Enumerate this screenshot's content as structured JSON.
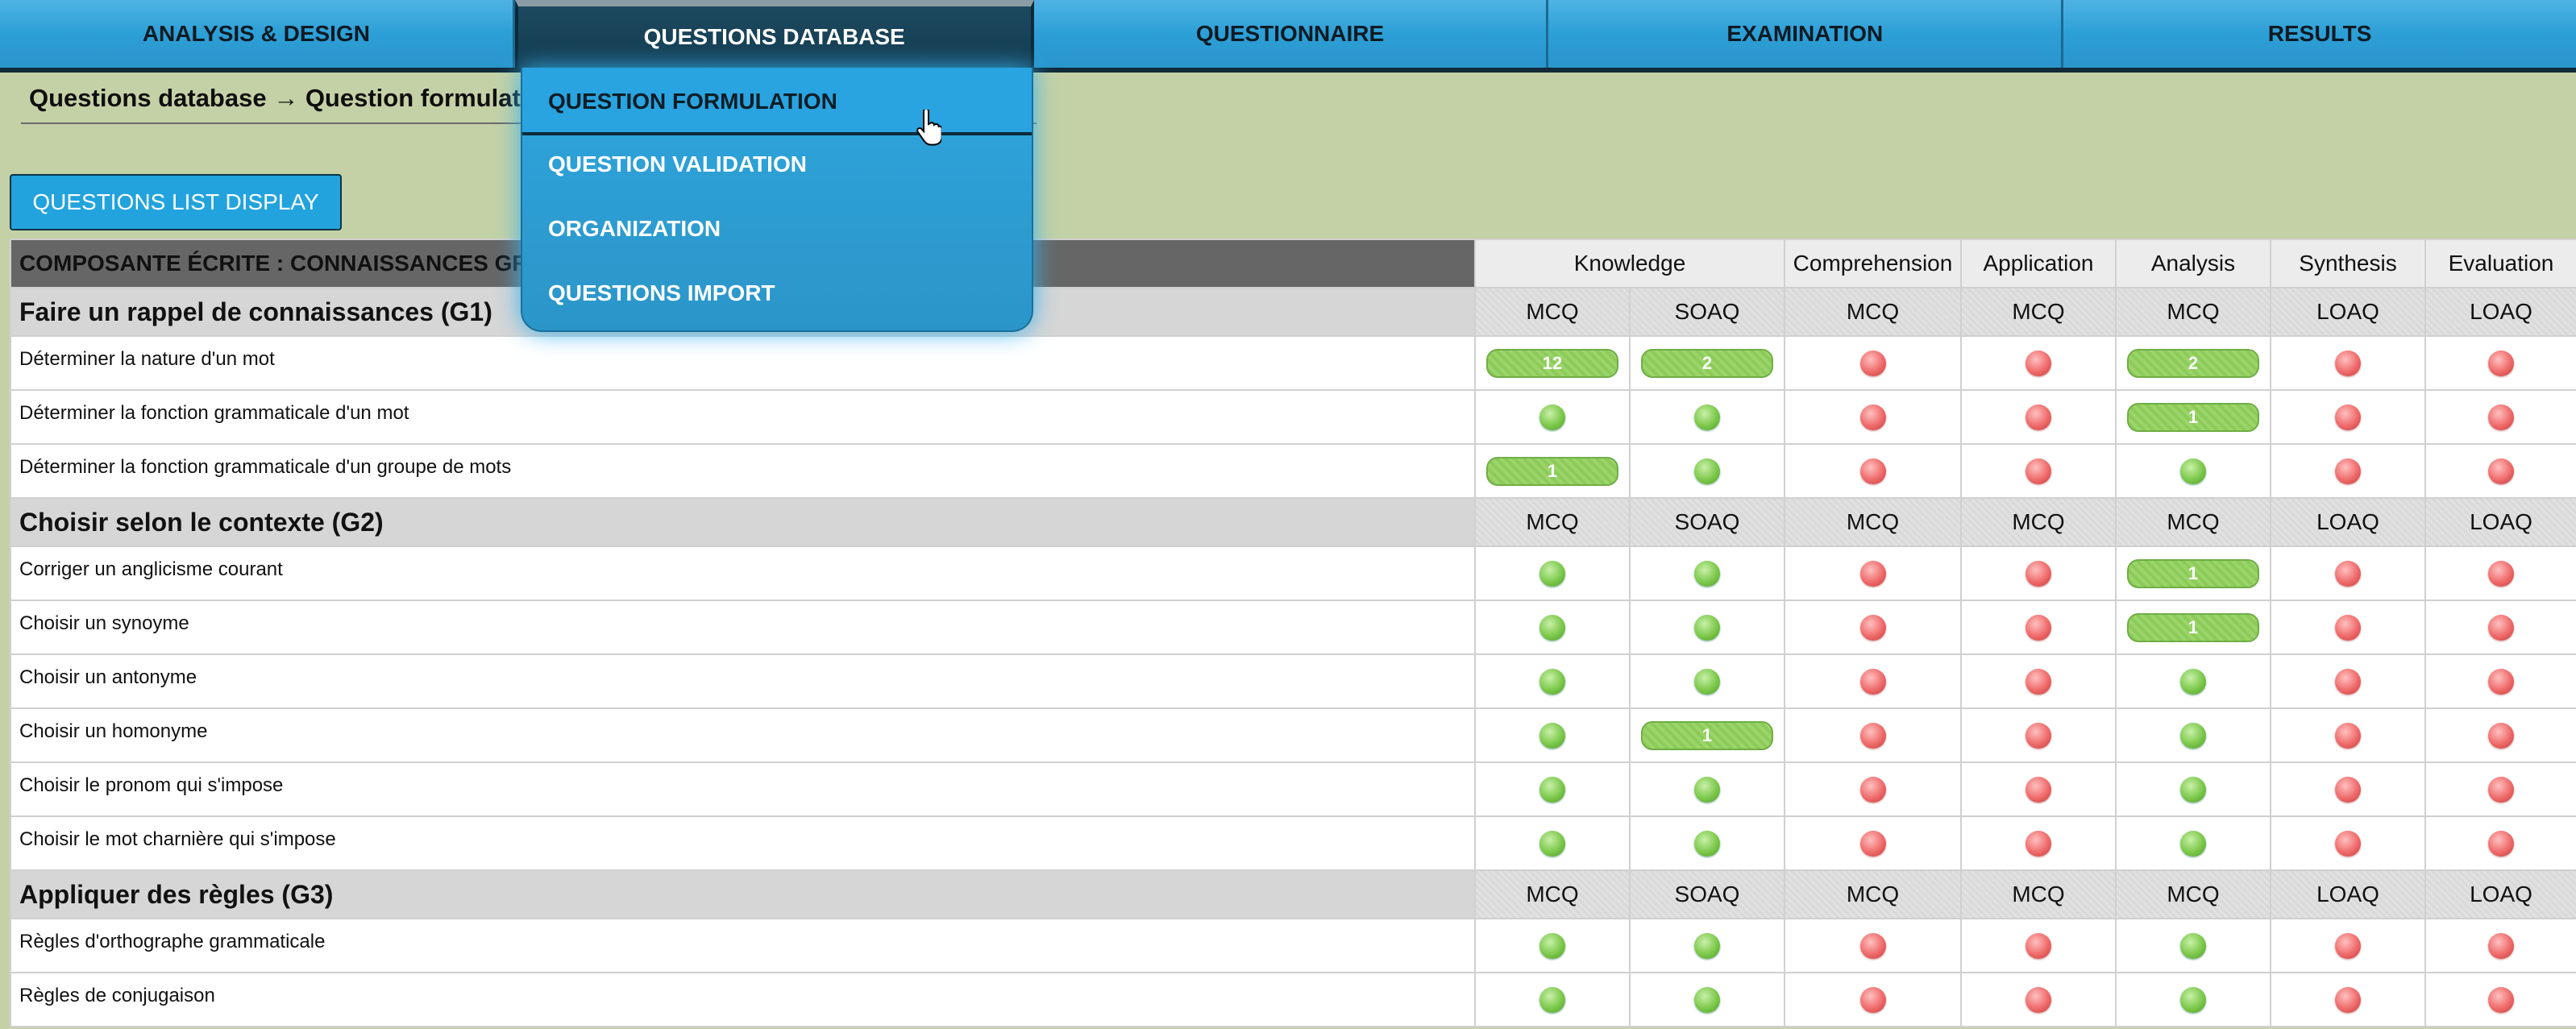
{
  "nav": {
    "items": [
      {
        "label": "ANALYSIS & DESIGN"
      },
      {
        "label": "QUESTIONS DATABASE",
        "active": true
      },
      {
        "label": "QUESTIONNAIRE"
      },
      {
        "label": "EXAMINATION"
      },
      {
        "label": "RESULTS"
      }
    ]
  },
  "breadcrumb": "Questions database → Question formulation",
  "list_button": "QUESTIONS LIST DISPLAY",
  "dropdown": {
    "items": [
      "QUESTION FORMULATION",
      "QUESTION VALIDATION",
      "ORGANIZATION",
      "QUESTIONS IMPORT"
    ]
  },
  "table": {
    "title": "COMPOSANTE ÉCRITE : CONNAISSANCES GR",
    "categories": [
      "Knowledge",
      "Comprehension",
      "Application",
      "Analysis",
      "Synthesis",
      "Evaluation"
    ],
    "groups": [
      {
        "name": "Faire un rappel de connaissances (G1)",
        "types": [
          "MCQ",
          "SOAQ",
          "MCQ",
          "MCQ",
          "MCQ",
          "LOAQ",
          "LOAQ"
        ],
        "rows": [
          {
            "label": "Déterminer la nature d'un mot",
            "cells": [
              "12",
              "2",
              "r",
              "r",
              "2",
              "r",
              "r"
            ]
          },
          {
            "label": "Déterminer la fonction grammaticale d'un mot",
            "cells": [
              "g",
              "g",
              "r",
              "r",
              "1",
              "r",
              "r"
            ]
          },
          {
            "label": "Déterminer la fonction grammaticale d'un groupe de mots",
            "cells": [
              "1",
              "g",
              "r",
              "r",
              "g",
              "r",
              "r"
            ]
          }
        ]
      },
      {
        "name": "Choisir selon le contexte (G2)",
        "types": [
          "MCQ",
          "SOAQ",
          "MCQ",
          "MCQ",
          "MCQ",
          "LOAQ",
          "LOAQ"
        ],
        "rows": [
          {
            "label": "Corriger un anglicisme courant",
            "cells": [
              "g",
              "g",
              "r",
              "r",
              "1",
              "r",
              "r"
            ]
          },
          {
            "label": "Choisir un synoyme",
            "cells": [
              "g",
              "g",
              "r",
              "r",
              "1",
              "r",
              "r"
            ]
          },
          {
            "label": "Choisir un antonyme",
            "cells": [
              "g",
              "g",
              "r",
              "r",
              "g",
              "r",
              "r"
            ]
          },
          {
            "label": "Choisir un homonyme",
            "cells": [
              "g",
              "1",
              "r",
              "r",
              "g",
              "r",
              "r"
            ]
          },
          {
            "label": "Choisir le pronom qui s'impose",
            "cells": [
              "g",
              "g",
              "r",
              "r",
              "g",
              "r",
              "r"
            ]
          },
          {
            "label": "Choisir le mot charnière qui s'impose",
            "cells": [
              "g",
              "g",
              "r",
              "r",
              "g",
              "r",
              "r"
            ]
          }
        ]
      },
      {
        "name": "Appliquer des règles (G3)",
        "types": [
          "MCQ",
          "SOAQ",
          "MCQ",
          "MCQ",
          "MCQ",
          "LOAQ",
          "LOAQ"
        ],
        "rows": [
          {
            "label": "Règles d'orthographe grammaticale",
            "cells": [
              "g",
              "g",
              "r",
              "r",
              "g",
              "r",
              "r"
            ]
          },
          {
            "label": "Règles de conjugaison",
            "cells": [
              "g",
              "g",
              "r",
              "r",
              "g",
              "r",
              "r"
            ]
          }
        ]
      }
    ]
  },
  "colors": {
    "green": "#7cc84a",
    "red": "#ef6a6a",
    "accent": "#2c9fd6"
  }
}
